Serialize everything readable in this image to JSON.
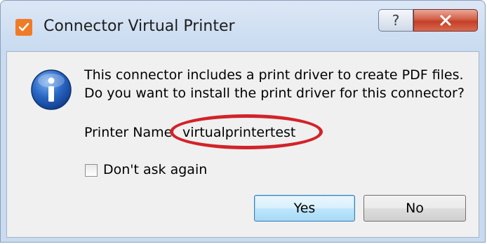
{
  "window": {
    "title": "Connector Virtual Printer",
    "help_label": "?",
    "close_label": "X"
  },
  "message": {
    "line1": "This connector includes a print driver to create PDF files.",
    "line2": "Do you want to install the print driver for this connector?"
  },
  "printer": {
    "label": "Printer Name",
    "value": "virtualprintertest"
  },
  "checkbox": {
    "label": "Don't ask again",
    "checked": false
  },
  "buttons": {
    "yes": "Yes",
    "no": "No"
  },
  "icons": {
    "app": "app-check-icon",
    "info": "info-icon"
  },
  "colors": {
    "app_icon": "#f07b26",
    "close_button": "#c94a33",
    "highlight": "#d2232a"
  }
}
